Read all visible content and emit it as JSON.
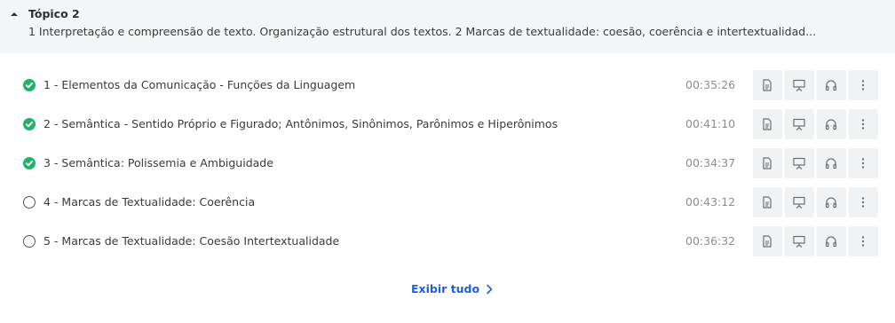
{
  "topic": {
    "title": "Tópico 2",
    "description": "1 Interpretação e compreensão de texto. Organização estrutural dos textos. 2 Marcas de textualidade: coesão, coerência e intertextualidad..."
  },
  "lessons": [
    {
      "title": "1 - Elementos da Comunicação - Funções da Linguagem",
      "duration": "00:35:26",
      "completed": true
    },
    {
      "title": "2 - Semântica - Sentido Próprio e Figurado; Antônimos, Sinônimos, Parônimos e Hiperônimos",
      "duration": "00:41:10",
      "completed": true
    },
    {
      "title": "3 - Semântica: Polissemia e Ambiguidade",
      "duration": "00:34:37",
      "completed": true
    },
    {
      "title": "4 - Marcas de Textualidade: Coerência",
      "duration": "00:43:12",
      "completed": false
    },
    {
      "title": "5 - Marcas de Textualidade: Coesão Intertextualidade",
      "duration": "00:36:32",
      "completed": false
    }
  ],
  "actions": [
    "document-icon",
    "slides-icon",
    "headphones-icon",
    "more-vertical-icon"
  ],
  "show_all_label": "Exibir tudo",
  "colors": {
    "accent": "#1f5fd6",
    "completed": "#23b26d",
    "header_bg": "#f4f5f6",
    "action_bg": "#f1f2f3"
  }
}
